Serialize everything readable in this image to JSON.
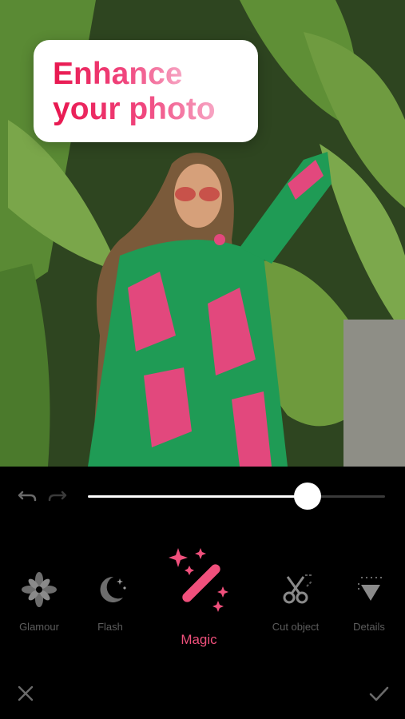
{
  "headline": {
    "line1": "Enhance",
    "line2": "your photo"
  },
  "slider": {
    "value_percent": 74
  },
  "tools": [
    {
      "label": "Glamour",
      "icon": "flower-icon"
    },
    {
      "label": "Flash",
      "icon": "moon-stars-icon"
    },
    {
      "label": "Magic",
      "icon": "magic-wand-icon",
      "active": true
    },
    {
      "label": "Cut object",
      "icon": "scissors-icon"
    },
    {
      "label": "Details",
      "icon": "triangle-details-icon"
    }
  ],
  "colors": {
    "accent": "#f0507c",
    "background": "#000000",
    "inactive": "#5d5d5d"
  }
}
